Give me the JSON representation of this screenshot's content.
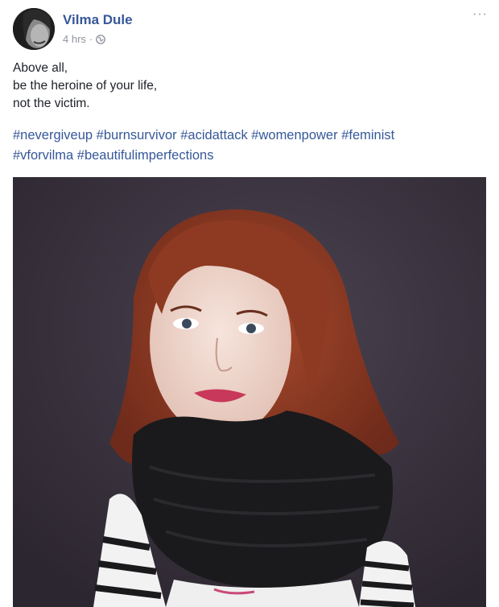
{
  "post": {
    "author": "Vilma Dule",
    "time": "4 hrs",
    "separator": "·",
    "privacy_icon": "globe-icon",
    "more_label": "···",
    "text_lines": [
      "Above all,",
      "be the heroine of your life,",
      "not the victim."
    ],
    "hashtags_line1": [
      "#nevergiveup",
      "#burnsurvivor",
      "#acidattack",
      "#womenpower",
      "#feminist"
    ],
    "hashtags_line2": [
      "#vforvilma",
      "#beautifulimperfections"
    ],
    "photo_icon": "portrait-photo"
  },
  "colors": {
    "link": "#365899",
    "text": "#1d2129",
    "meta": "#90949c"
  }
}
